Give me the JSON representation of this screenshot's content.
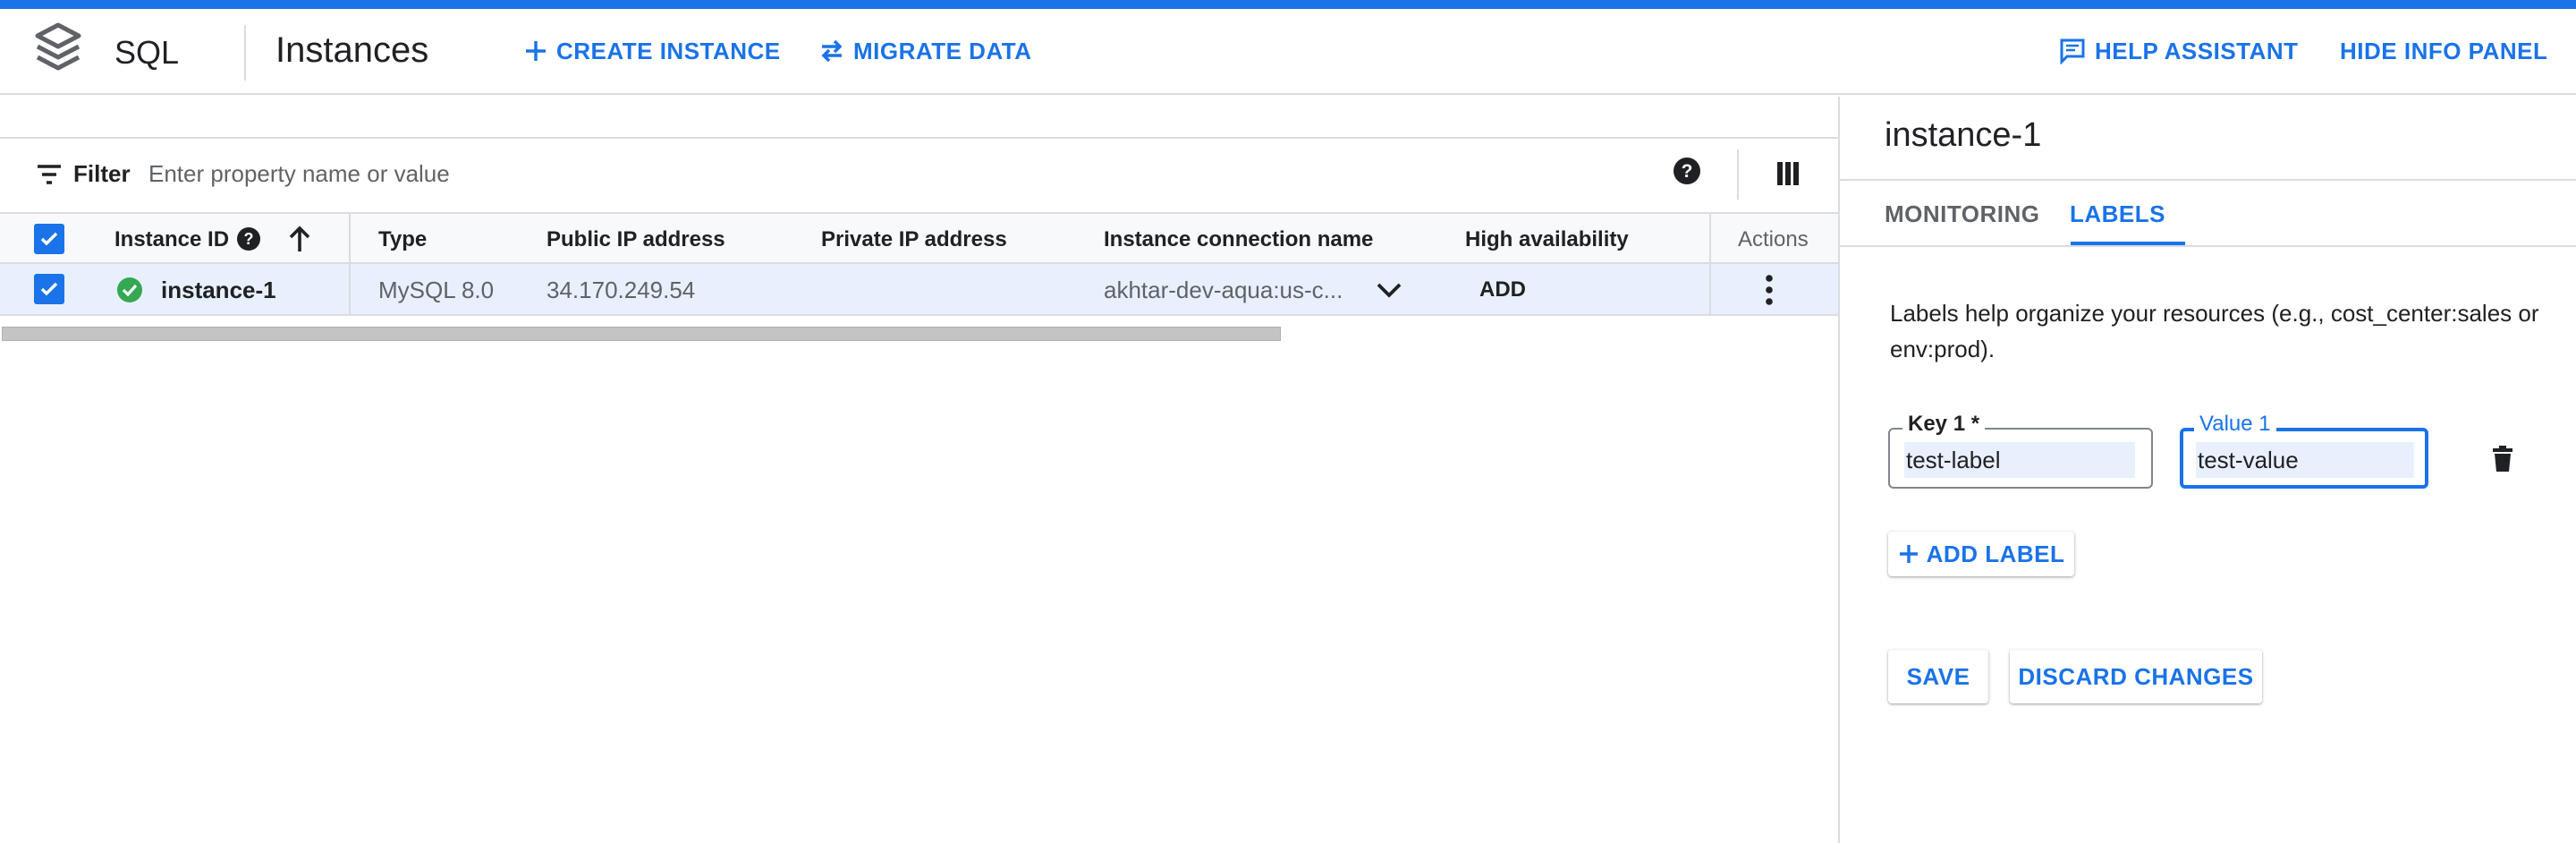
{
  "header": {
    "product": "SQL",
    "page_title": "Instances",
    "create_label": "CREATE INSTANCE",
    "migrate_label": "MIGRATE DATA",
    "help_assistant_label": "HELP ASSISTANT",
    "hide_info_label": "HIDE INFO PANEL"
  },
  "filter": {
    "label": "Filter",
    "placeholder": "Enter property name or value"
  },
  "table": {
    "columns": {
      "instance_id": "Instance ID",
      "type": "Type",
      "public_ip": "Public IP address",
      "private_ip": "Private IP address",
      "connection": "Instance connection name",
      "ha": "High availability",
      "actions": "Actions"
    },
    "rows": [
      {
        "instance_id": "instance-1",
        "type": "MySQL 8.0",
        "public_ip": "34.170.249.54",
        "private_ip": "",
        "connection": "akhtar-dev-aqua:us-c...",
        "ha": "ADD"
      }
    ]
  },
  "panel": {
    "title": "instance-1",
    "tabs": [
      "MONITORING",
      "LABELS"
    ],
    "active_tab": "LABELS",
    "description": "Labels help organize your resources (e.g., cost_center:sales or env:prod).",
    "key_label": "Key 1 *",
    "key_value": "test-label",
    "value_label": "Value 1",
    "value_value": "test-value",
    "add_label": "ADD LABEL",
    "save_label": "SAVE",
    "discard_label": "DISCARD CHANGES"
  },
  "colors": {
    "accent": "#1a73e8",
    "status_ok": "#34a853",
    "selected_row": "#e8f0fe"
  }
}
